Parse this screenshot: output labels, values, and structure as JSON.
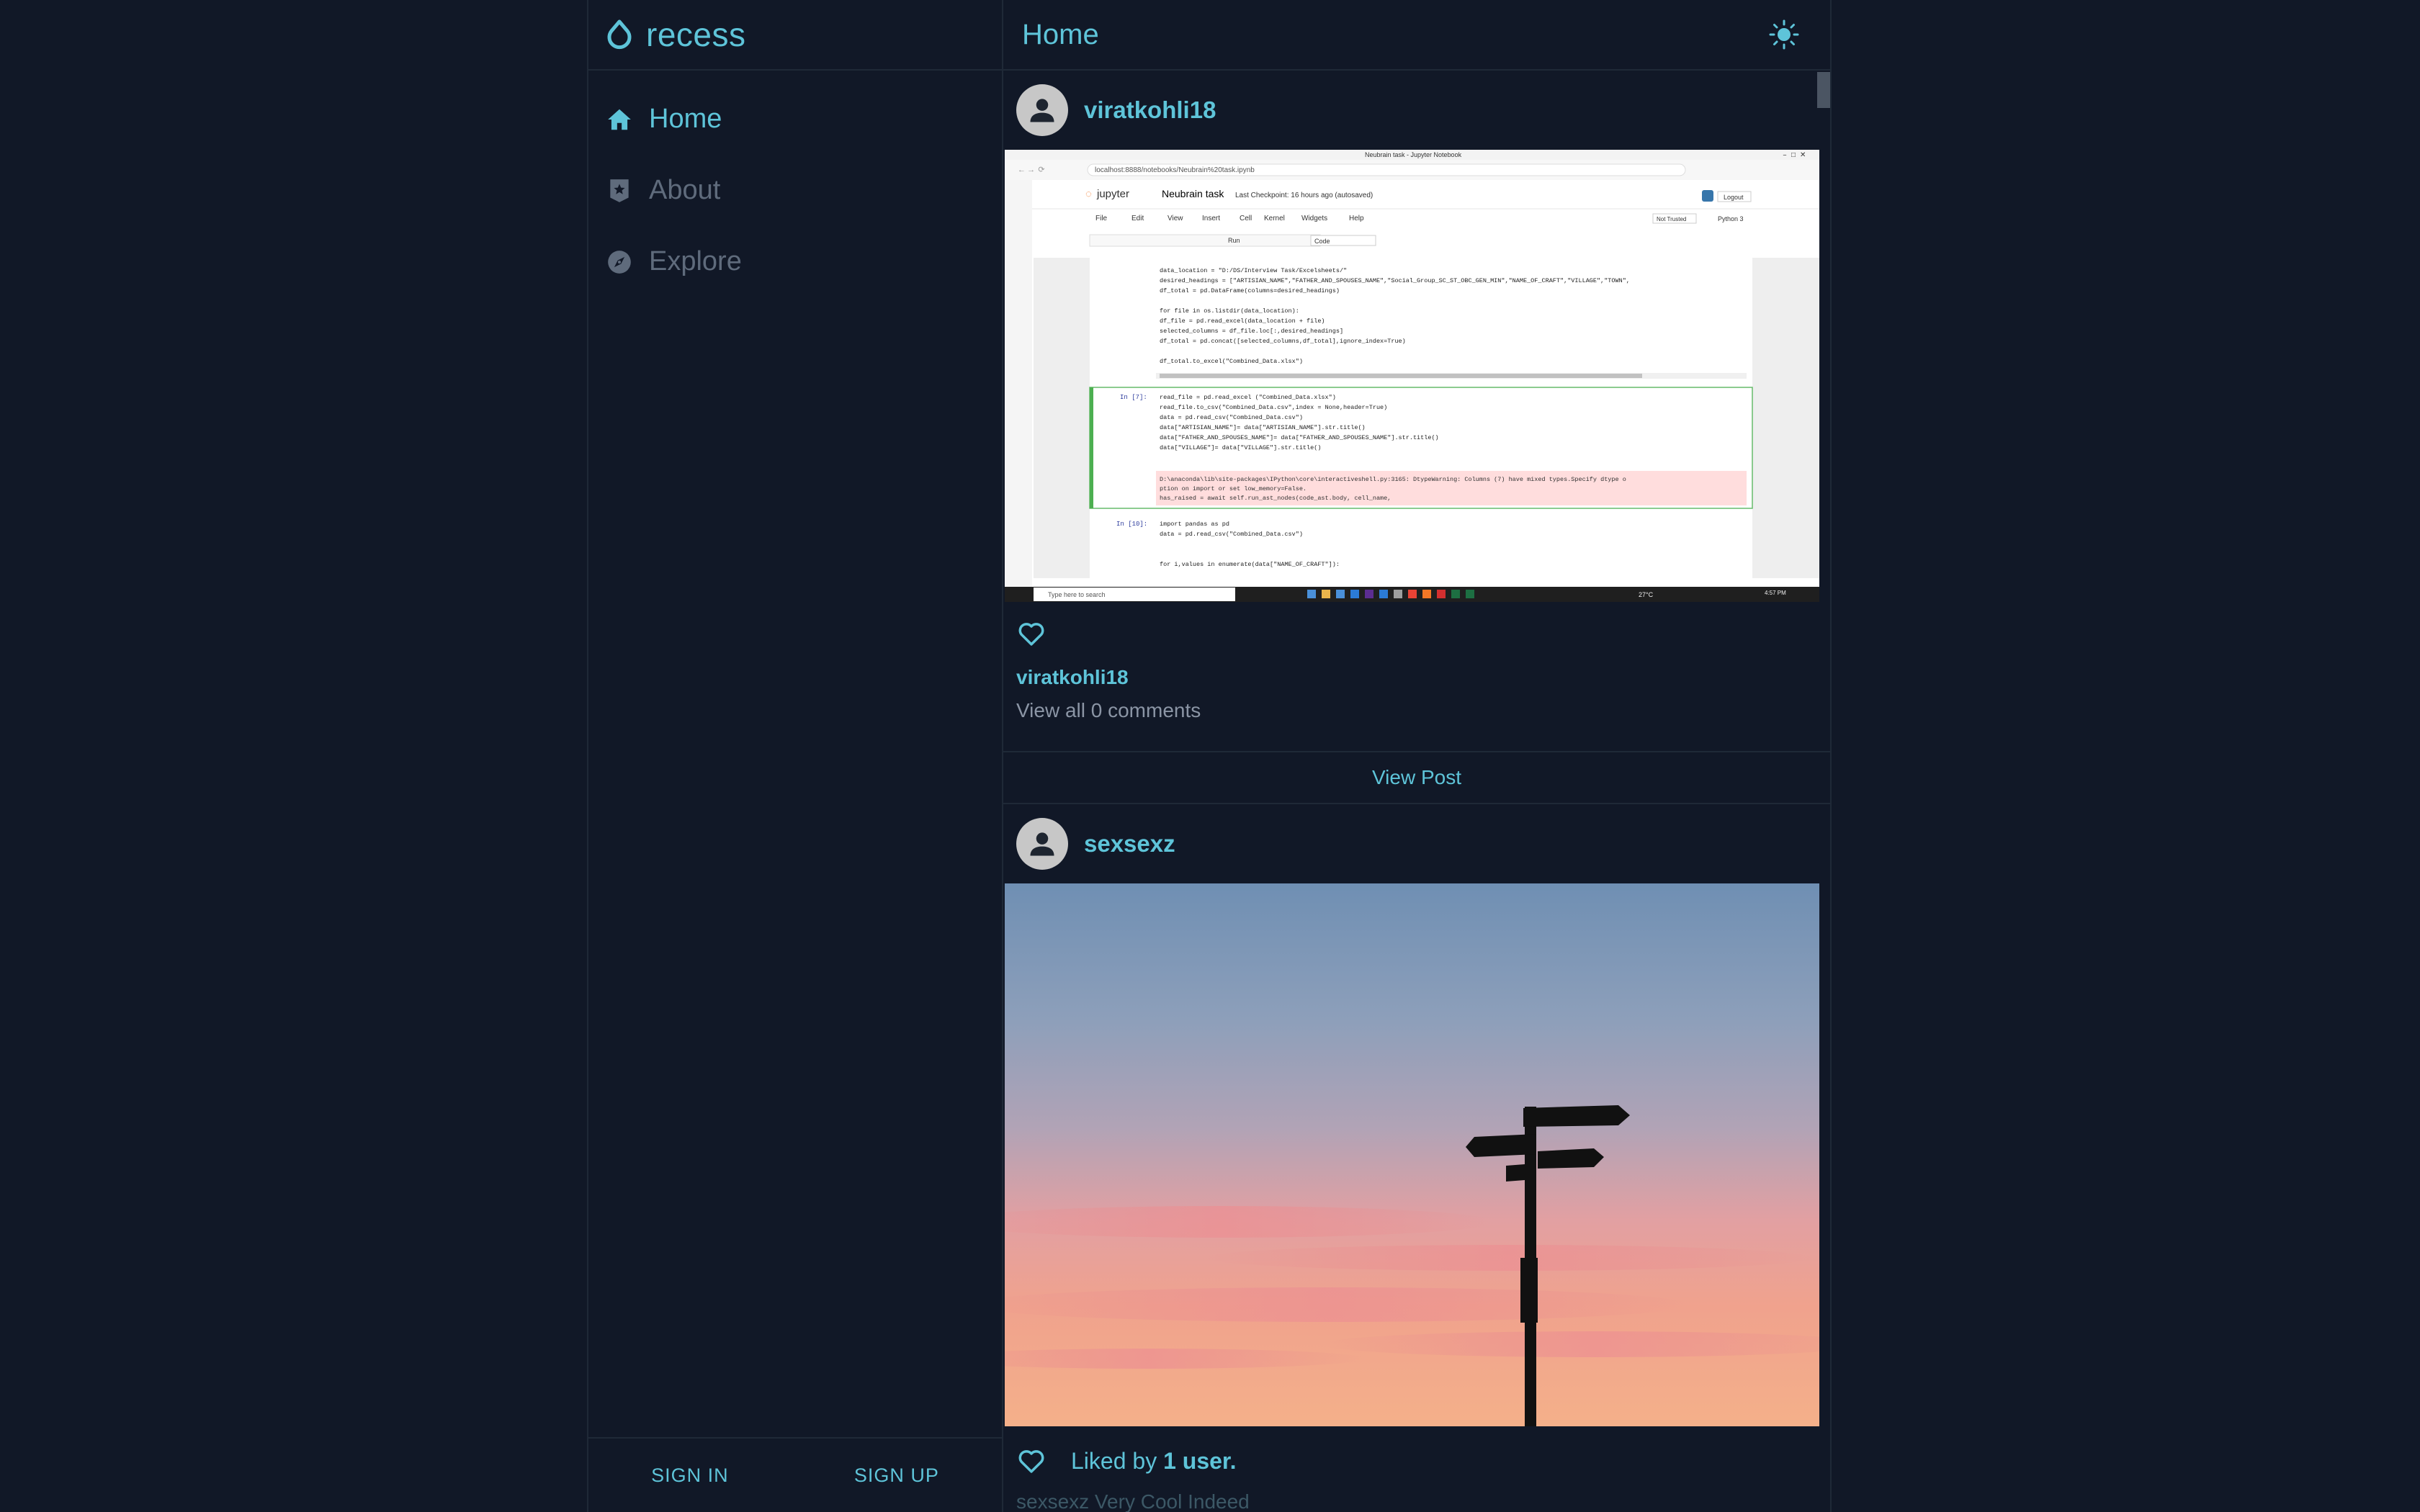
{
  "app": {
    "brand": "recess"
  },
  "sidebar": {
    "items": [
      {
        "label": "Home",
        "icon": "home-icon",
        "active": true
      },
      {
        "label": "About",
        "icon": "badge-icon",
        "active": false
      },
      {
        "label": "Explore",
        "icon": "compass-icon",
        "active": false
      }
    ],
    "sign_in": "SIGN IN",
    "sign_up": "SIGN UP"
  },
  "header": {
    "title": "Home",
    "theme_icon": "sun-icon"
  },
  "posts": [
    {
      "username": "viratkohli18",
      "image": "screenshot of a Jupyter notebook in a browser",
      "caption_user": "viratkohli18",
      "comments_link": "View all 0 comments",
      "view_post": "View Post",
      "notebook": {
        "tab_title": "Neubrain task - Jupyter Notebook",
        "url": "localhost:8888/notebooks/Neubrain%20task.ipynb",
        "app_name": "jupyter",
        "nb_title": "Neubrain task",
        "checkpoint": "Last Checkpoint: 16 hours ago  (autosaved)",
        "logout": "Logout",
        "menus": [
          "File",
          "Edit",
          "View",
          "Insert",
          "Cell",
          "Kernel",
          "Widgets",
          "Help"
        ],
        "kernel": "Python 3",
        "trusted": "Not Trusted",
        "run": "Run",
        "cell_type": "Code",
        "code1": [
          "data_location = \"D:/DS/Interview Task/Excelsheets/\"",
          "desired_headings = [\"ARTISIAN_NAME\",\"FATHER_AND_SPOUSES_NAME\",\"Social_Group_SC_ST_OBC_GEN_MIN\",\"NAME_OF_CRAFT\",\"VILLAGE\",\"TOWN\",",
          "df_total = pd.DataFrame(columns=desired_headings)",
          "",
          "for file in os.listdir(data_location):",
          "    df_file = pd.read_excel(data_location + file)",
          "    selected_columns = df_file.loc[:,desired_headings]",
          "    df_total = pd.concat([selected_columns,df_total],ignore_index=True)",
          "",
          "df_total.to_excel(\"Combined_Data.xlsx\")"
        ],
        "prompt2": "In [7]:",
        "code2": [
          "read_file = pd.read_excel (\"Combined_Data.xlsx\")",
          "read_file.to_csv(\"Combined_Data.csv\",index = None,header=True)",
          "data = pd.read_csv(\"Combined_Data.csv\")",
          "data[\"ARTISIAN_NAME\"]= data[\"ARTISIAN_NAME\"].str.title()",
          "data[\"FATHER_AND_SPOUSES_NAME\"]= data[\"FATHER_AND_SPOUSES_NAME\"].str.title()",
          "data[\"VILLAGE\"]= data[\"VILLAGE\"].str.title()"
        ],
        "warning": [
          "D:\\anaconda\\lib\\site-packages\\IPython\\core\\interactiveshell.py:3165: DtypeWarning: Columns (7) have mixed types.Specify dtype o",
          "ption on import or set low_memory=False.",
          "  has_raised = await self.run_ast_nodes(code_ast.body, cell_name,"
        ],
        "prompt3": "In [10]:",
        "code3": [
          "import pandas as pd",
          "data = pd.read_csv(\"Combined_Data.csv\")",
          "",
          "",
          "for i,values in enumerate(data[\"NAME_OF_CRAFT\"]):"
        ],
        "taskbar_search": "Type here to search",
        "temp": "27°C",
        "clock": "4:57 PM"
      }
    },
    {
      "username": "sexsexz",
      "image": "silhouette of a signpost against a sunset sky",
      "liked_prefix": "Liked by ",
      "liked_count": "1 user.",
      "caption": "sexsexz Very Cool Indeed"
    }
  ],
  "colors": {
    "background": "#111827",
    "accent": "#5ec4d9",
    "muted": "#5f6b7c",
    "border": "#1f2937"
  }
}
